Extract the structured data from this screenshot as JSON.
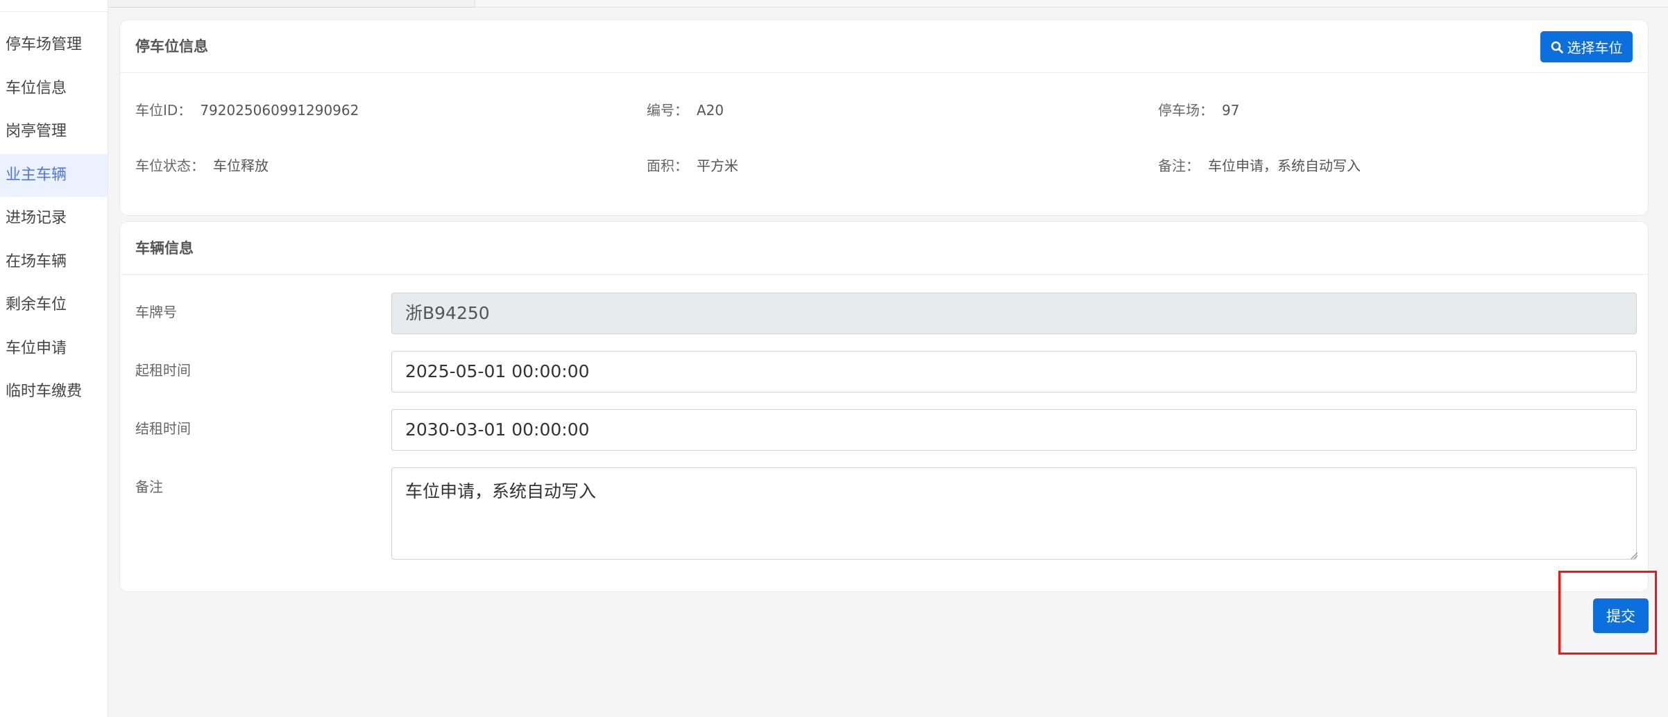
{
  "sidebar": {
    "items": [
      {
        "label": "停车场管理",
        "active": false
      },
      {
        "label": "车位信息",
        "active": false
      },
      {
        "label": "岗亭管理",
        "active": false
      },
      {
        "label": "业主车辆",
        "active": true
      },
      {
        "label": "进场记录",
        "active": false
      },
      {
        "label": "在场车辆",
        "active": false
      },
      {
        "label": "剩余车位",
        "active": false
      },
      {
        "label": "车位申请",
        "active": false
      },
      {
        "label": "临时车缴费",
        "active": false
      }
    ]
  },
  "parking_card": {
    "title": "停车位信息",
    "select_button": {
      "label": "选择车位",
      "icon": "search-icon"
    },
    "fields": {
      "space_id": {
        "label": "车位ID：",
        "value": "792025060991290962"
      },
      "number": {
        "label": "编号：",
        "value": "A20"
      },
      "lot": {
        "label": "停车场：",
        "value": "97"
      },
      "status": {
        "label": "车位状态：",
        "value": "车位释放"
      },
      "area": {
        "label": "面积：",
        "value": "平方米"
      },
      "remark": {
        "label": "备注：",
        "value": "车位申请，系统自动写入"
      }
    }
  },
  "vehicle_card": {
    "title": "车辆信息",
    "fields": {
      "plate": {
        "label": "车牌号",
        "value": "浙B94250",
        "disabled": true
      },
      "start_time": {
        "label": "起租时间",
        "value": "2025-05-01 00:00:00"
      },
      "end_time": {
        "label": "结租时间",
        "value": "2030-03-01 00:00:00"
      },
      "remark": {
        "label": "备注",
        "value": "车位申请，系统自动写入"
      }
    }
  },
  "submit_button": {
    "label": "提交"
  },
  "colors": {
    "primary": "#0b6fde",
    "sidebar_active_bg": "#ebf1ff",
    "sidebar_active_text": "#4a78e8",
    "highlight": "#ff1010"
  }
}
